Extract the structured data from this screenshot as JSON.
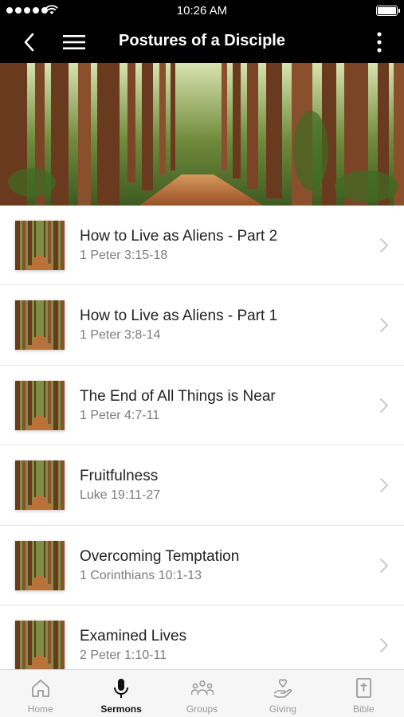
{
  "status_bar": {
    "time": "10:26 AM"
  },
  "nav": {
    "title": "Postures of a Disciple",
    "back_icon": "chevron-left-icon",
    "menu_icon": "hamburger-icon",
    "more_icon": "more-vertical-icon"
  },
  "colors": {
    "bar_background": "#000000",
    "subtitle_gray": "#7c7c7c",
    "tab_active": "#111111",
    "tab_inactive": "#9a9a9a"
  },
  "sermons": [
    {
      "title": "How to Live as Aliens - Part 2",
      "reference": "1 Peter 3:15-18"
    },
    {
      "title": "How to Live as Aliens - Part 1",
      "reference": "1 Peter 3:8-14"
    },
    {
      "title": "The End of All Things is Near",
      "reference": "1 Peter 4:7-11"
    },
    {
      "title": "Fruitfulness",
      "reference": "Luke 19:11-27"
    },
    {
      "title": "Overcoming Temptation",
      "reference": "1 Corinthians 10:1-13"
    },
    {
      "title": "Examined Lives",
      "reference": "2 Peter 1:10-11"
    }
  ],
  "tabs": [
    {
      "label": "Home",
      "icon": "home-icon",
      "active": false
    },
    {
      "label": "Sermons",
      "icon": "microphone-icon",
      "active": true
    },
    {
      "label": "Groups",
      "icon": "groups-icon",
      "active": false
    },
    {
      "label": "Giving",
      "icon": "giving-hand-icon",
      "active": false
    },
    {
      "label": "Bible",
      "icon": "bible-icon",
      "active": false
    }
  ]
}
